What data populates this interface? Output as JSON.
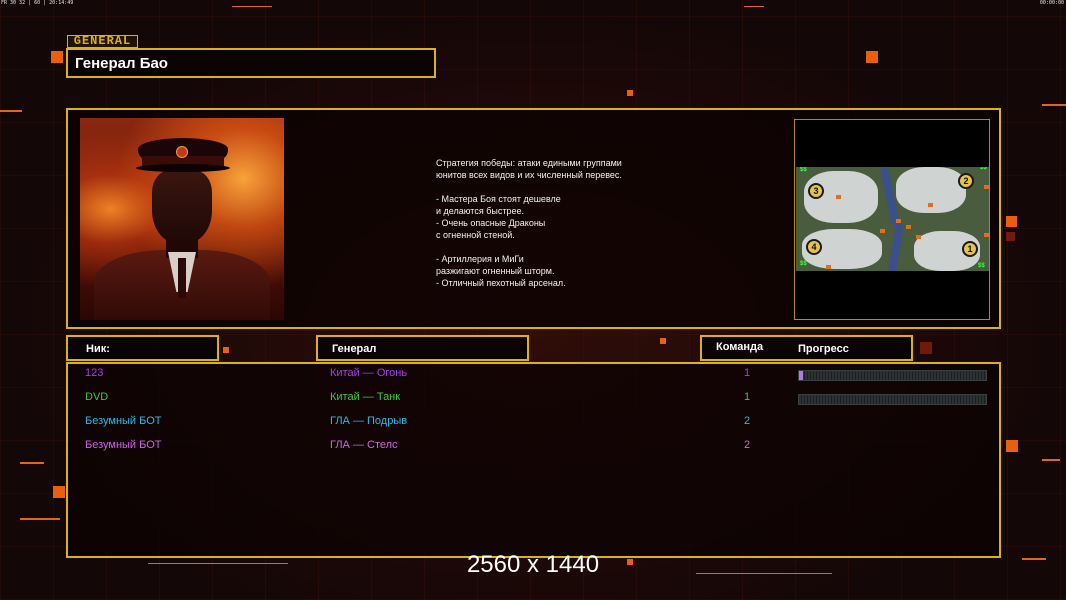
{
  "topbar": {
    "left": "FR 30 32 | 60 | 20:14:49",
    "right": "00:00:00"
  },
  "header": {
    "tag": "GENERAL",
    "name": "Генерал Бао"
  },
  "portrait": {
    "icon": "general-portrait"
  },
  "description": "Стратегия победы: атаки едиными группами\nюнитов всех видов и их численный перевес.\n\n- Мастера Боя стоят дешевле\nи делаются быстрее.\n- Очень опасные Драконы\nс огненной стеной.\n\n- Артиллерия и МиГи\nразжигают огненный шторм.\n- Отличный пехотный арсенал.",
  "minimap": {
    "markers": [
      "1",
      "2",
      "3",
      "4"
    ],
    "cash_label": "$$"
  },
  "columns": {
    "nick": "Ник:",
    "general": "Генерал",
    "team": "Команда",
    "progress": "Прогресс"
  },
  "players": [
    {
      "nick": "123",
      "general": "Китай — Огонь",
      "team": "1",
      "color": "#a040e8",
      "progress": 0.02,
      "show_bar": true
    },
    {
      "nick": "DVD",
      "general": "Китай — Танк",
      "team": "1",
      "color": "#40c838",
      "progress": 0.0,
      "show_bar": true
    },
    {
      "nick": "Безумный БОТ",
      "general": "ГЛА — Подрыв",
      "team": "2",
      "color": "#30b8e8",
      "progress": 0.0,
      "show_bar": false
    },
    {
      "nick": "Безумный БОТ",
      "general": "ГЛА — Стелс",
      "team": "2",
      "color": "#d060e8",
      "progress": 0.0,
      "show_bar": false
    }
  ],
  "resolution_label": "2560 x 1440",
  "colors": {
    "frame": "#d8b21c",
    "accent": "#ff7a1a"
  }
}
